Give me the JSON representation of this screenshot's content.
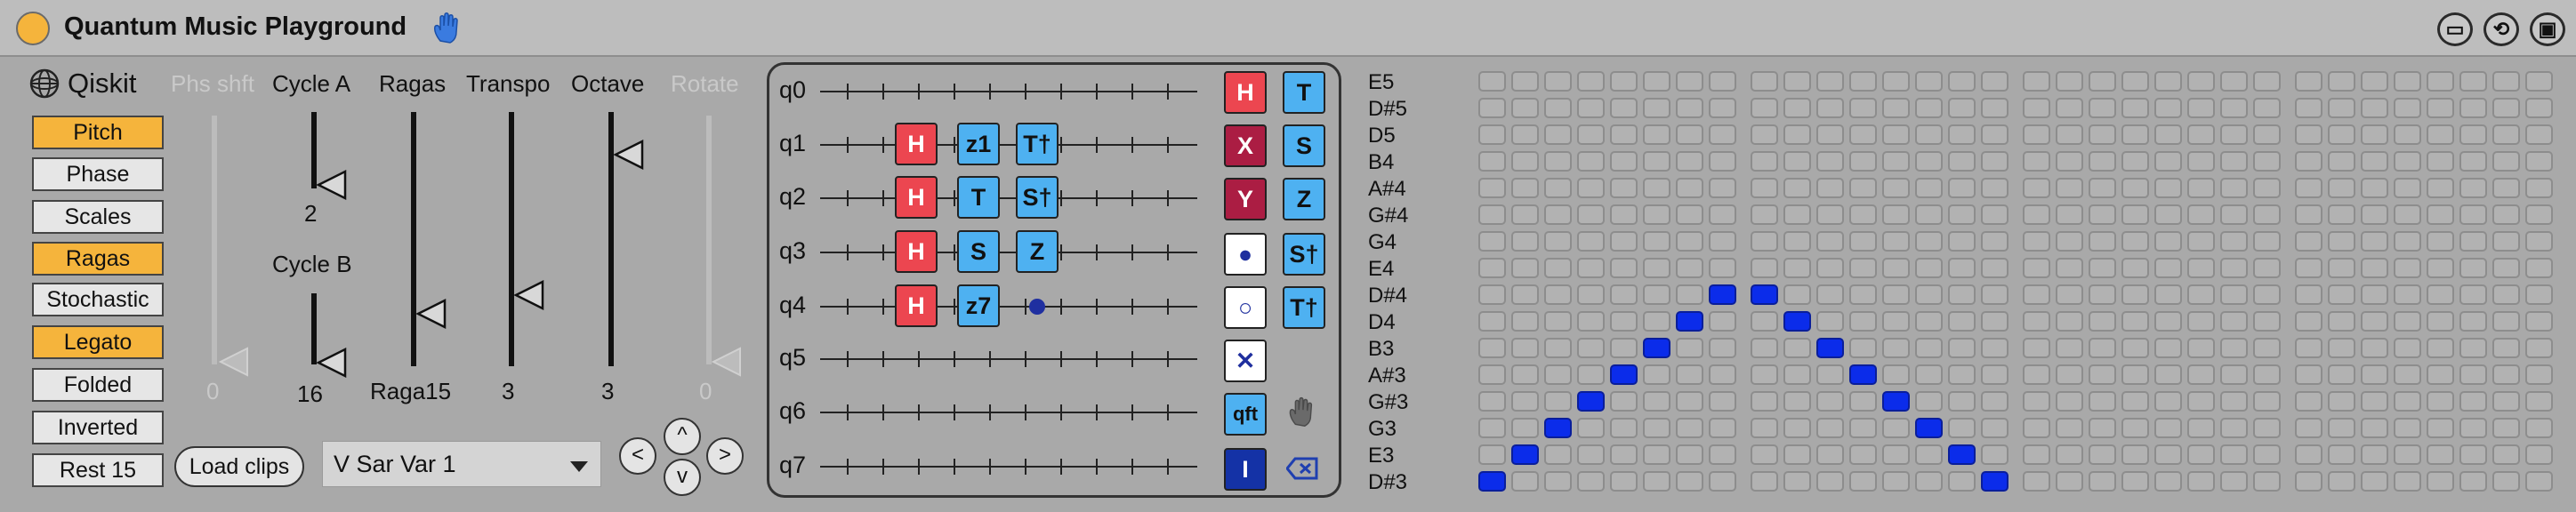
{
  "title": "Quantum Music Playground",
  "title_buttons": [
    "window-icon",
    "refresh-icon",
    "save-icon"
  ],
  "colors": {
    "accent": "#f5b43c",
    "red_gate": "#ec4650",
    "blue_gate": "#4eb1f1",
    "maroon_gate": "#ab1d43",
    "navy_gate": "#1432a6",
    "note_on": "#0b2cea"
  },
  "brand": {
    "name": "Qiskit"
  },
  "modes": [
    {
      "label": "Pitch",
      "active": true
    },
    {
      "label": "Phase",
      "active": false
    },
    {
      "label": "Scales",
      "active": false
    },
    {
      "label": "Ragas",
      "active": true
    },
    {
      "label": "Stochastic",
      "active": false
    },
    {
      "label": "Legato",
      "active": true
    },
    {
      "label": "Folded",
      "active": false
    },
    {
      "label": "Inverted",
      "active": false
    },
    {
      "label": "Rest 15",
      "active": false
    }
  ],
  "controls": {
    "phs_shft": {
      "label": "Phs shft",
      "value": "0"
    },
    "cycle_a": {
      "label": "Cycle A",
      "value": "2"
    },
    "cycle_b": {
      "label": "Cycle B",
      "value": "16"
    },
    "ragas": {
      "label": "Ragas",
      "value": "Raga15"
    },
    "transpo": {
      "label": "Transpo",
      "value": "3"
    },
    "octave": {
      "label": "Octave",
      "value": "3"
    },
    "rotate": {
      "label": "Rotate",
      "value": "0"
    }
  },
  "load_clips": "Load clips",
  "preset": {
    "selected": "V Sar Var 1"
  },
  "nav": {
    "left": "<",
    "up": "^",
    "right": ">",
    "down": "v"
  },
  "qubits": [
    "q0",
    "q1",
    "q2",
    "q3",
    "q4",
    "q5",
    "q6",
    "q7"
  ],
  "circuit_gates": [
    {
      "qubit": 1,
      "col": 0,
      "label": "H",
      "style": "red"
    },
    {
      "qubit": 1,
      "col": 1,
      "label": "z1",
      "style": "blue"
    },
    {
      "qubit": 1,
      "col": 2,
      "label": "T†",
      "style": "blue"
    },
    {
      "qubit": 2,
      "col": 0,
      "label": "H",
      "style": "red"
    },
    {
      "qubit": 2,
      "col": 1,
      "label": "T",
      "style": "blue"
    },
    {
      "qubit": 2,
      "col": 2,
      "label": "S†",
      "style": "blue"
    },
    {
      "qubit": 3,
      "col": 0,
      "label": "H",
      "style": "red"
    },
    {
      "qubit": 3,
      "col": 1,
      "label": "S",
      "style": "blue"
    },
    {
      "qubit": 3,
      "col": 2,
      "label": "Z",
      "style": "blue"
    },
    {
      "qubit": 4,
      "col": 0,
      "label": "H",
      "style": "red"
    },
    {
      "qubit": 4,
      "col": 1,
      "label": "z7",
      "style": "blue"
    }
  ],
  "control_dots": [
    {
      "qubit": 4,
      "col": 2
    }
  ],
  "palette_left": [
    {
      "label": "H",
      "style": "red",
      "name": "h-gate"
    },
    {
      "label": "X",
      "style": "maroon",
      "name": "x-gate"
    },
    {
      "label": "Y",
      "style": "maroon",
      "name": "y-gate"
    },
    {
      "label": "●",
      "style": "white",
      "name": "control-gate"
    },
    {
      "label": "○",
      "style": "white",
      "name": "anti-control-gate"
    },
    {
      "label": "✕",
      "style": "white",
      "name": "swap-gate"
    },
    {
      "label": "qft",
      "style": "blue",
      "name": "qft-gate"
    },
    {
      "label": "I",
      "style": "navy",
      "name": "identity-gate"
    }
  ],
  "palette_right": [
    {
      "label": "T",
      "style": "blue",
      "name": "t-gate"
    },
    {
      "label": "S",
      "style": "blue",
      "name": "s-gate"
    },
    {
      "label": "Z",
      "style": "blue",
      "name": "z-gate"
    },
    {
      "label": "S†",
      "style": "blue",
      "name": "s-dagger-gate"
    },
    {
      "label": "T†",
      "style": "blue",
      "name": "t-dagger-gate"
    }
  ],
  "notes": [
    "E5",
    "D#5",
    "D5",
    "B4",
    "A#4",
    "G#4",
    "G4",
    "E4",
    "D#4",
    "D4",
    "B3",
    "A#3",
    "G#3",
    "G3",
    "E3",
    "D#3"
  ],
  "note_grid": {
    "columns": 32,
    "group_size": 8,
    "active": [
      [
        0,
        15
      ],
      [
        1,
        14
      ],
      [
        2,
        13
      ],
      [
        3,
        12
      ],
      [
        4,
        11
      ],
      [
        5,
        10
      ],
      [
        6,
        9
      ],
      [
        7,
        8
      ],
      [
        8,
        8
      ],
      [
        9,
        9
      ],
      [
        10,
        10
      ],
      [
        11,
        11
      ],
      [
        12,
        12
      ],
      [
        13,
        13
      ],
      [
        14,
        14
      ],
      [
        15,
        15
      ]
    ]
  }
}
